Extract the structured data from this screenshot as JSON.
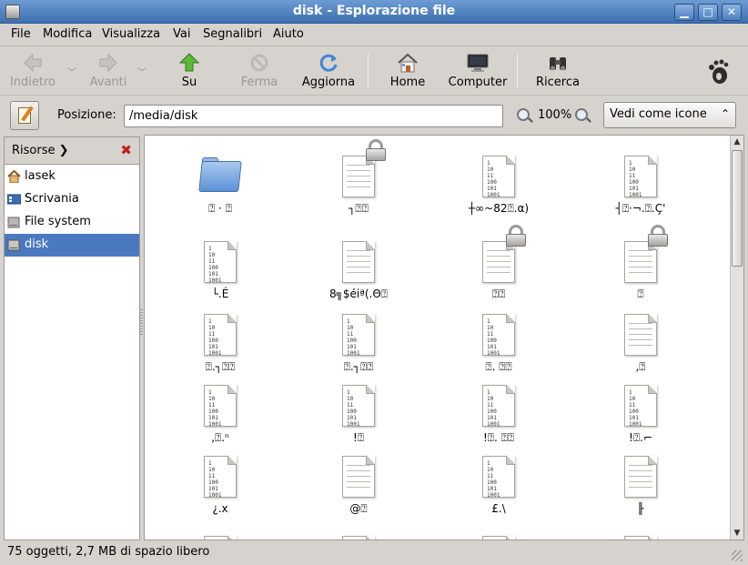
{
  "window": {
    "title": "disk - Esplorazione file"
  },
  "menu": [
    {
      "label": "File",
      "accel": "F"
    },
    {
      "label": "Modifica",
      "accel": "M"
    },
    {
      "label": "Visualizza",
      "accel": "V"
    },
    {
      "label": "Vai",
      "accel": "a"
    },
    {
      "label": "Segnalibri",
      "accel": "e"
    },
    {
      "label": "Aiuto",
      "accel": "i"
    }
  ],
  "toolbar": {
    "back": "Indietro",
    "forward": "Avanti",
    "up": "Su",
    "stop": "Ferma",
    "reload": "Aggiorna",
    "home": "Home",
    "computer": "Computer",
    "search": "Ricerca"
  },
  "location": {
    "label": "Posizione:",
    "path": "/media/disk",
    "zoom": "100%",
    "view_mode": "Vedi come icone"
  },
  "sidebar": {
    "header": "Risorse",
    "items": [
      {
        "label": "lasek",
        "icon": "home-folder-icon"
      },
      {
        "label": "Scrivania",
        "icon": "desktop-icon"
      },
      {
        "label": "File system",
        "icon": "drive-icon"
      },
      {
        "label": "disk",
        "icon": "drive-icon",
        "selected": true
      }
    ]
  },
  "files": [
    {
      "name": "⍰ ·  ⍰",
      "type": "folder"
    },
    {
      "name": "┐⍰⍰",
      "type": "text",
      "locked": true
    },
    {
      "name": "┼∞~82⍰.α)",
      "type": "binary"
    },
    {
      "name": "┤⍰·¬.⍰.Ç'",
      "type": "binary"
    },
    {
      "name": "└.É",
      "type": "binary"
    },
    {
      "name": "8╗$éiª(.Θ⍰",
      "type": "text"
    },
    {
      "name": "⍰⍰",
      "type": "text",
      "locked": true
    },
    {
      "name": "⍰",
      "type": "text",
      "locked": true
    },
    {
      "name": "⍰.┐⍰⍰",
      "type": "binary"
    },
    {
      "name": "⍰.┐⍰⍰",
      "type": "binary"
    },
    {
      "name": "⍰. ⍰⍰",
      "type": "binary"
    },
    {
      "name": ",⍰",
      "type": "text"
    },
    {
      "name": ",⍰.ⁿ",
      "type": "binary"
    },
    {
      "name": "!⍰",
      "type": "binary"
    },
    {
      "name": "!⍰. ⍰⍰",
      "type": "binary"
    },
    {
      "name": "!⍰.⌐",
      "type": "binary"
    },
    {
      "name": "¿.x",
      "type": "binary"
    },
    {
      "name": "@⍰",
      "type": "text"
    },
    {
      "name": "£.\\",
      "type": "binary"
    },
    {
      "name": "╟",
      "type": "text"
    }
  ],
  "status": "75 oggetti, 2,7 MB di spazio libero"
}
